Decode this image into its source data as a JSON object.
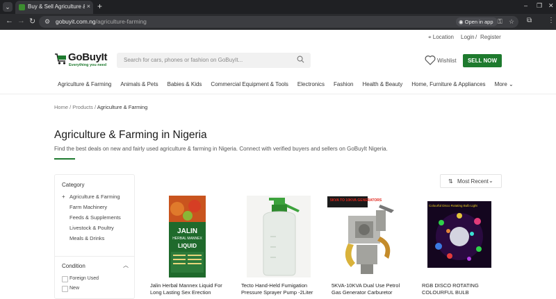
{
  "browser": {
    "tab_title": "Buy & Sell Agriculture & Farming",
    "tab_close": "×",
    "new_tab": "+",
    "url_host": "gobuyit.com.ng",
    "url_path": "/agriculture-farming",
    "open_in_app": "Open in app"
  },
  "header": {
    "location": "Location",
    "login": "Login",
    "sep": "/",
    "register": "Register",
    "logo_name": "GoBuyIt",
    "logo_tagline": "Everything you need",
    "search_placeholder": "Search for cars, phones or fashion on GoBuyIt...",
    "wishlist": "Wishlist",
    "sell_now": "SELL NOW"
  },
  "nav": [
    "Agriculture & Farming",
    "Animals & Pets",
    "Babies & Kids",
    "Commercial Equipment & Tools",
    "Electronics",
    "Fashion",
    "Health & Beauty",
    "Home, Furniture & Appliances",
    "More"
  ],
  "breadcrumb": {
    "home": "Home",
    "products": "Products",
    "current": "Agriculture & Farming",
    "sep": " / "
  },
  "page": {
    "title": "Agriculture & Farming in Nigeria",
    "description": "Find the best deals on new and fairly used agriculture & farming in Nigeria. Connect with verified buyers and sellers on GoBuyIt Nigeria."
  },
  "sort": {
    "label": "Most Recent"
  },
  "sidebar": {
    "category_heading": "Category",
    "root_category": "Agriculture & Farming",
    "subcategories": [
      "Farm Machinery",
      "Feeds & Supplements",
      "Livestock & Poultry",
      "Meals & Drinks"
    ],
    "condition_heading": "Condition",
    "conditions": [
      "Foreign Used",
      "New"
    ]
  },
  "products": [
    {
      "title": "Jalin Herbal Mannex Liquid For Long Lasting Sex Erection"
    },
    {
      "title": "Tecto Hand-Held Fumigation Pressure Sprayer Pump -2Liter"
    },
    {
      "title": "5KVA-10KVA Dual Use Petrol Gas Generator Carburetor"
    },
    {
      "title": "RGB DISCO ROTATING COLOURFUL BULB"
    }
  ],
  "product_image_text": {
    "bottle_brand": "JALIN",
    "bottle_line": "HERBAL MANNEX",
    "bottle_word": "LIQUID",
    "carb_banner": "5KVA TO 10KVA GENERATORS",
    "disco_banner": "Colourful Disco Rotating Bulb Light"
  },
  "colors": {
    "brand_green": "#1e7a2e",
    "chrome_dark": "#1f2023"
  },
  "icons": {
    "location": "location-pin-icon",
    "search": "search-icon",
    "wishlist": "heart-icon",
    "sort": "sort-icon",
    "more": "chevron-down-icon"
  }
}
